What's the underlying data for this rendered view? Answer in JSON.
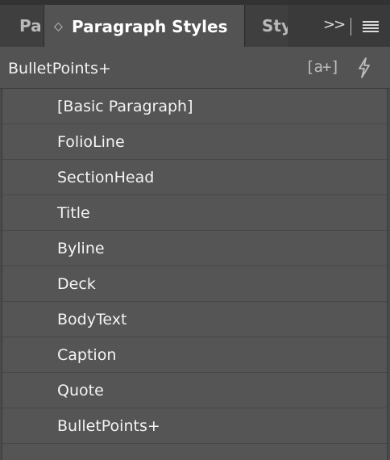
{
  "tabs": {
    "left_label": "Pa",
    "active_label": "Paragraph Styles",
    "right_label": "Sty",
    "overflow_glyph": ">>"
  },
  "header": {
    "current_style": "BulletPoints+",
    "new_style_glyph": "[a+]"
  },
  "styles": [
    {
      "label": "[Basic Paragraph]"
    },
    {
      "label": "FolioLine"
    },
    {
      "label": "SectionHead"
    },
    {
      "label": "Title"
    },
    {
      "label": "Byline"
    },
    {
      "label": "Deck"
    },
    {
      "label": "BodyText"
    },
    {
      "label": "Caption"
    },
    {
      "label": "Quote"
    },
    {
      "label": "BulletPoints+"
    }
  ],
  "colors": {
    "panel_bg": "#535353",
    "tabbar_bg": "#3a3a3a",
    "list_bg": "#555555",
    "text": "#f4f4f4"
  }
}
